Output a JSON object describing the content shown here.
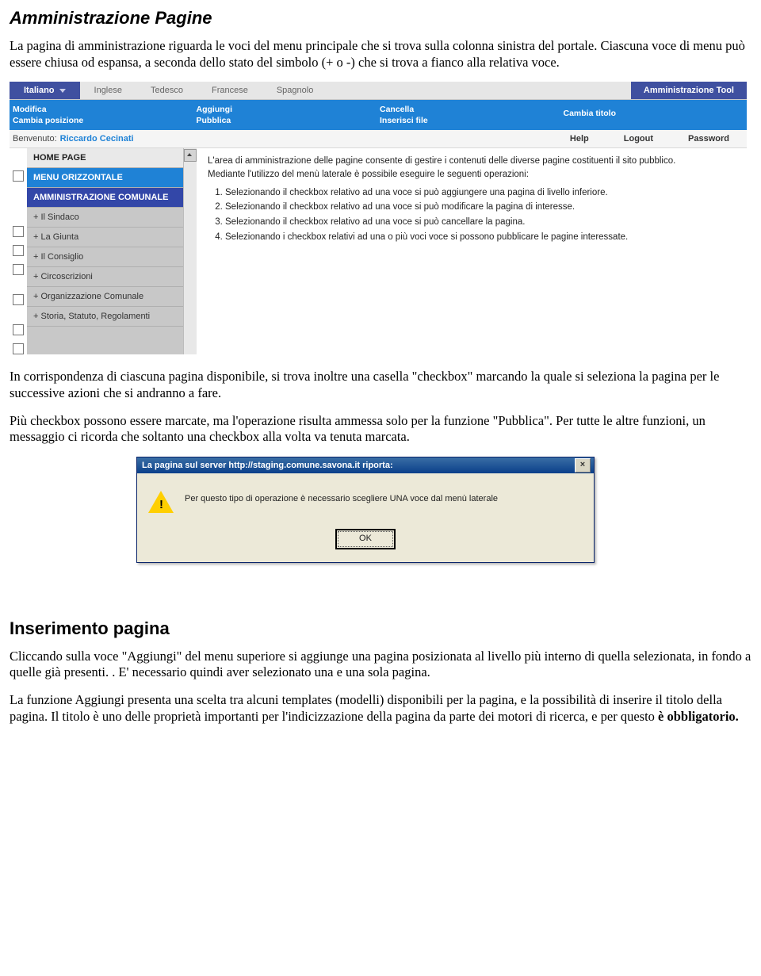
{
  "heading1": "Amministrazione Pagine",
  "p1": "La pagina di amministrazione riguarda le voci del menu principale  che si trova sulla colonna sinistra del portale. Ciascuna voce di menu può essere chiusa od espansa, a seconda dello stato del simbolo (+ o -) che si trova a fianco alla relativa voce.",
  "langs": {
    "active": "Italiano",
    "others": [
      "Inglese",
      "Tedesco",
      "Francese",
      "Spagnolo"
    ],
    "admtool": "Amministrazione Tool"
  },
  "bluecols": [
    [
      "Modifica",
      "Cambia posizione"
    ],
    [
      "Aggiungi",
      "Pubblica"
    ],
    [
      "Cancella",
      "Inserisci file"
    ],
    [
      "Cambia titolo",
      ""
    ]
  ],
  "welcome": {
    "label": "Benvenuto:",
    "name": "Riccardo Cecinati",
    "links": [
      "Help",
      "Logout",
      "Password"
    ]
  },
  "sidebar": [
    "HOME PAGE",
    "MENU ORIZZONTALE",
    "AMMINISTRAZIONE COMUNALE",
    "+ Il Sindaco",
    "+ La Giunta",
    "+ Il Consiglio",
    "+ Circoscrizioni",
    "+ Organizzazione Comunale",
    "+ Storia, Statuto, Regolamenti"
  ],
  "content": {
    "p1": "L'area di amministrazione delle pagine consente di gestire i contenuti delle diverse pagine costituenti il sito pubblico.",
    "p2": "Mediante l'utilizzo del menù laterale è possibile eseguire le seguenti operazioni:",
    "li": [
      "Selezionando il checkbox relativo ad una voce si può aggiungere una pagina di livello inferiore.",
      "Selezionando il checkbox relativo ad una voce si può modificare la pagina di interesse.",
      "Selezionando il checkbox relativo ad una voce si può cancellare la pagina.",
      "Selezionando i checkbox relativi ad una o più voci voce si possono pubblicare le pagine interessate."
    ]
  },
  "p2": "In corrispondenza di ciascuna pagina disponibile, si trova inoltre una casella \"checkbox\" marcando la quale si seleziona la pagina per le successive azioni che si andranno a fare.",
  "p3": "Più checkbox possono essere marcate, ma l'operazione risulta ammessa solo per la funzione \"Pubblica\". Per tutte le altre funzioni, un messaggio ci ricorda che soltanto una checkbox alla volta va tenuta marcata.",
  "dialog": {
    "title": "La pagina sul server http://staging.comune.savona.it riporta:",
    "msg": "Per questo tipo di operazione è necessario scegliere UNA voce dal menù laterale",
    "ok": "OK"
  },
  "heading2": "Inserimento pagina",
  "p4": "Cliccando sulla voce \"Aggiungi\" del menu superiore si aggiunge una pagina posizionata al livello più interno di quella selezionata, in fondo a quelle già presenti. . E' necessario quindi aver selezionato una e una sola pagina.",
  "p5a": "La funzione Aggiungi presenta una scelta tra alcuni templates (modelli) disponibili per la pagina, e la possibilità di inserire il titolo della pagina. Il titolo è uno delle proprietà importanti per l'indicizzazione della pagina da parte dei motori di ricerca, e per questo ",
  "p5b": "è obbligatorio."
}
